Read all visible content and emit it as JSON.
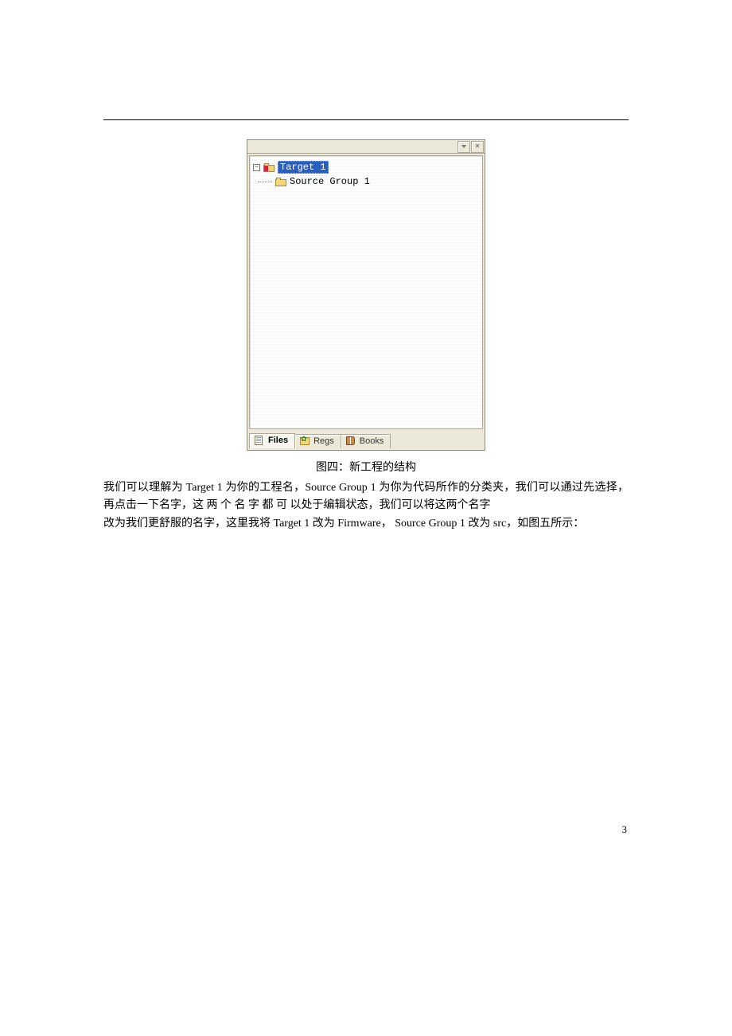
{
  "panel": {
    "tree": {
      "target_label": "Target 1",
      "group_label": "Source Group 1"
    },
    "tabs": {
      "files": "Files",
      "regs": "Regs",
      "books": "Books"
    }
  },
  "caption": "图四：新工程的结构",
  "paragraphs": {
    "p1": "我们可以理解为  Target 1 为你的工程名，Source Group 1 为你为代码所作的分类夹，我们可以通过先选择，再点击一下名字，这 两 个 名 字 都 可 以处于编辑状态，我们可以将这两个名字",
    "p2": "改为我们更舒服的名字，这里我将  Target 1 改为  Firmware，  Source Group 1 改为  src，如图五所示："
  },
  "page_number": "3"
}
